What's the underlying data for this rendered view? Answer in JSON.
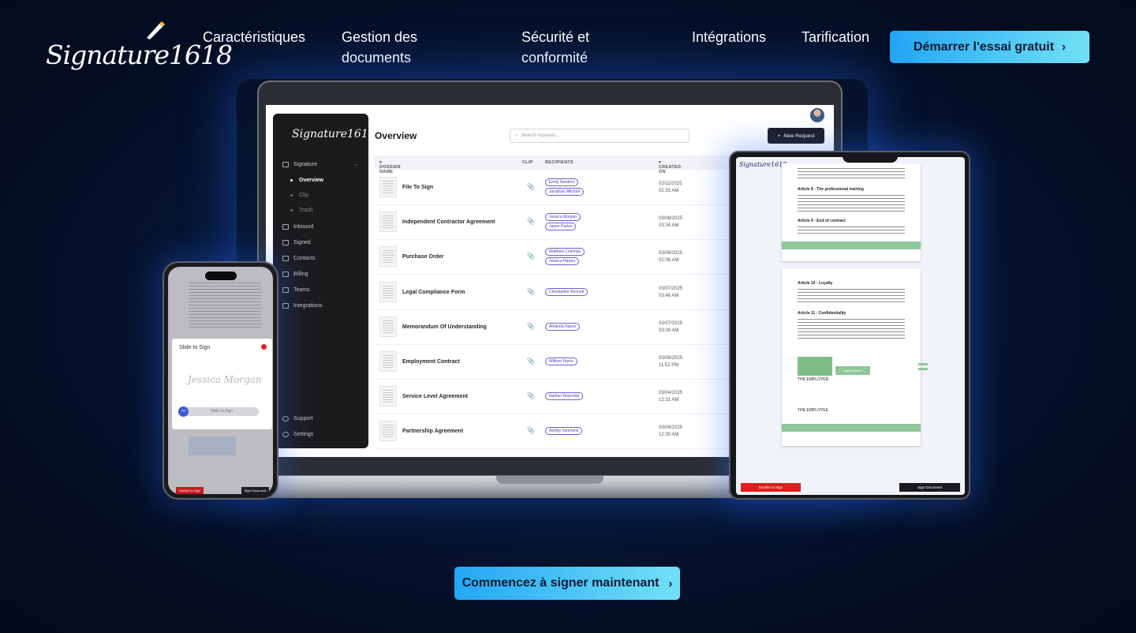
{
  "brand": {
    "logo_text": "Signature1618",
    "accent_gradient": [
      "#23a6f4",
      "#72e1f7"
    ]
  },
  "nav": {
    "items": [
      {
        "label": "Caractéristiques"
      },
      {
        "label": "Gestion des documents"
      },
      {
        "label": "Sécurité et conformité"
      },
      {
        "label": "Intégrations"
      },
      {
        "label": "Tarification"
      }
    ],
    "cta_label": "Démarrer l'essai gratuit"
  },
  "hero": {
    "cta_label": "Commencez à signer maintenant"
  },
  "app": {
    "logo": "Signature1618",
    "title": "Overview",
    "search_placeholder": "Search requests...",
    "new_request_label": "New Request",
    "sidebar": {
      "group": "Signature",
      "sub_items": [
        "Overview",
        "Clip",
        "Trash"
      ],
      "items": [
        "Inbound",
        "Signed",
        "Contacts",
        "Billing",
        "Teams",
        "Integrations"
      ],
      "bottom": [
        "Support",
        "Settings"
      ]
    },
    "table": {
      "headers": [
        "DOSSIER NAME",
        "CLIP",
        "RECIPIENTS",
        "CREATED ON"
      ],
      "rows": [
        {
          "name": "File To Sign",
          "clip": "gray",
          "recipients": [
            "Emily Sanders",
            "Jonathan Mitchell"
          ],
          "date": "03/11/2025",
          "time": "02:33 AM"
        },
        {
          "name": "Independent Contractor Agreement",
          "clip": "gray",
          "recipients": [
            "Jessica Morgan",
            "Jason Parker"
          ],
          "date": "03/08/2025",
          "time": "03:34 AM"
        },
        {
          "name": "Purchase Order",
          "clip": "gray",
          "recipients": [
            "Matthew Coleman",
            "Jessica Harper"
          ],
          "date": "03/08/2025",
          "time": "02:06 AM"
        },
        {
          "name": "Legal Compliance Form",
          "clip": "gray",
          "recipients": [
            "Christopher Bennett"
          ],
          "date": "03/07/2025",
          "time": "03:48 AM"
        },
        {
          "name": "Memorandum Of Understanding",
          "clip": "gray",
          "recipients": [
            "Amanda Hayes"
          ],
          "date": "03/07/2025",
          "time": "03:39 AM"
        },
        {
          "name": "Employment Contract",
          "clip": "gray",
          "recipients": [
            "William Harris"
          ],
          "date": "03/06/2025",
          "time": "11:52 PM"
        },
        {
          "name": "Service Level Agreement",
          "clip": "yellow",
          "recipients": [
            "Nathan Reynolds"
          ],
          "date": "03/04/2025",
          "time": "12:31 AM"
        },
        {
          "name": "Partnership Agreement",
          "clip": "yellow",
          "recipients": [
            "Ashley Simmons"
          ],
          "date": "03/04/2025",
          "time": "12:30 AM"
        }
      ]
    }
  },
  "tablet": {
    "logo": "Signature1618",
    "article8": "Article 8 : The professional training",
    "article9": "Article 9 : End of contract",
    "article10": "Article 10 : Loyalty",
    "article11": "Article 11 : Confidentiality",
    "legal_mention": "Legal mention",
    "employer": "THE EMPLOYER",
    "employee": "THE EMPLOYEE",
    "decline_label": "Decline to Sign",
    "sign_label": "Sign Document"
  },
  "phone": {
    "sheet_title": "Slide to Sign",
    "signature": "Jessica Morgan",
    "slider_label": "Slide to Sign",
    "decline_label": "Decline to Sign",
    "sign_label": "Sign Document"
  }
}
